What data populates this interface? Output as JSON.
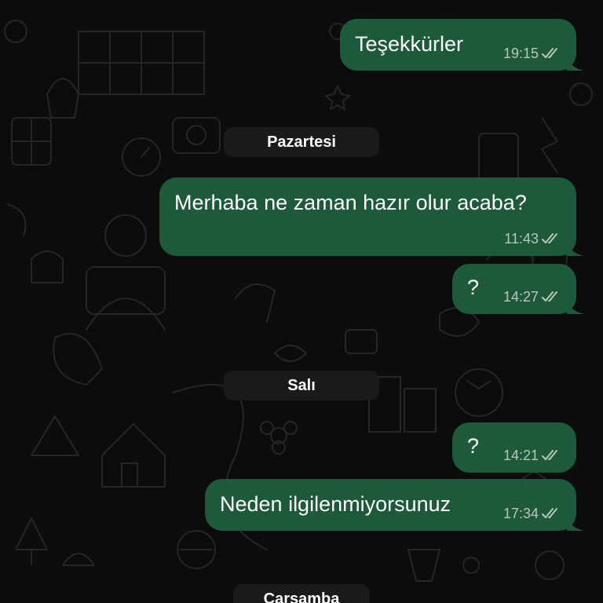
{
  "chat": {
    "colors": {
      "background": "#0c0c0c",
      "outgoing_bubble": "#1d5a3a",
      "date_pill": "#1a1a1a",
      "timestamp": "#b8c7be",
      "read_ticks": "#b8c7be"
    },
    "messages": [
      {
        "text": "Teşekkürler",
        "time": "19:15",
        "direction": "outgoing",
        "status": "read"
      },
      {
        "text": "Merhaba ne zaman hazır olur acaba?",
        "time": "11:43",
        "direction": "outgoing",
        "status": "read"
      },
      {
        "text": "?",
        "time": "14:27",
        "direction": "outgoing",
        "status": "read"
      },
      {
        "text": "?",
        "time": "14:21",
        "direction": "outgoing",
        "status": "read"
      },
      {
        "text": "Neden ilgilenmiyorsunuz",
        "time": "17:34",
        "direction": "outgoing",
        "status": "read"
      }
    ],
    "dates": [
      {
        "label": "Pazartesi"
      },
      {
        "label": "Salı"
      },
      {
        "label": "Çarşamba"
      }
    ],
    "icons": {
      "read_receipt": "double-check-icon",
      "wallpaper": "doodle-pattern"
    }
  }
}
